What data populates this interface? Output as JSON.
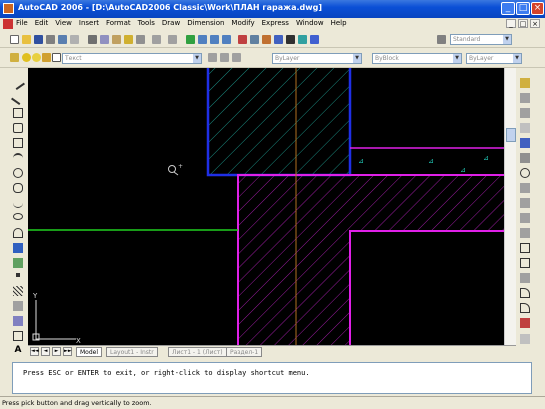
{
  "window": {
    "title": "AutoCAD 2006 - [D:\\AutoCAD2006 Classic\\Work\\ПЛАН гаража.dwg]",
    "minimize": "_",
    "maximize": "□",
    "close": "×"
  },
  "menu": {
    "items": [
      "File",
      "Edit",
      "View",
      "Insert",
      "Format",
      "Tools",
      "Draw",
      "Dimension",
      "Modify",
      "Express",
      "Window",
      "Help"
    ],
    "doc_controls": [
      "_",
      "□",
      "×"
    ]
  },
  "toolbar": {
    "text_style": "Standard",
    "layer": "Тексt",
    "color": "ByLayer",
    "linetype": "ByBlock",
    "lineweight": "ByLayer"
  },
  "tabs": {
    "items": [
      "Model",
      "Layout1 - Instr",
      "Лист1 - 1 (Лист)",
      "Раздел-1"
    ],
    "active": "Model",
    "nav": [
      "◄◄",
      "◄",
      "►",
      "►►"
    ]
  },
  "command": {
    "prompt": "Press ESC or ENTER to exit, or right-click to display shortcut menu."
  },
  "status": {
    "text": "Press pick button and drag vertically to zoom."
  },
  "ucs": {
    "x": "X",
    "y": "Y"
  },
  "colors": {
    "background": "#000000",
    "blue_wall": "#1f2fe6",
    "cyan_hatch": "#1a8a80",
    "magenta_wall": "#e020e8",
    "magenta_hatch": "#9a1ca0",
    "green_line": "#20d020",
    "center_line": "#b07020",
    "title_bar": "#0a4fd6"
  }
}
